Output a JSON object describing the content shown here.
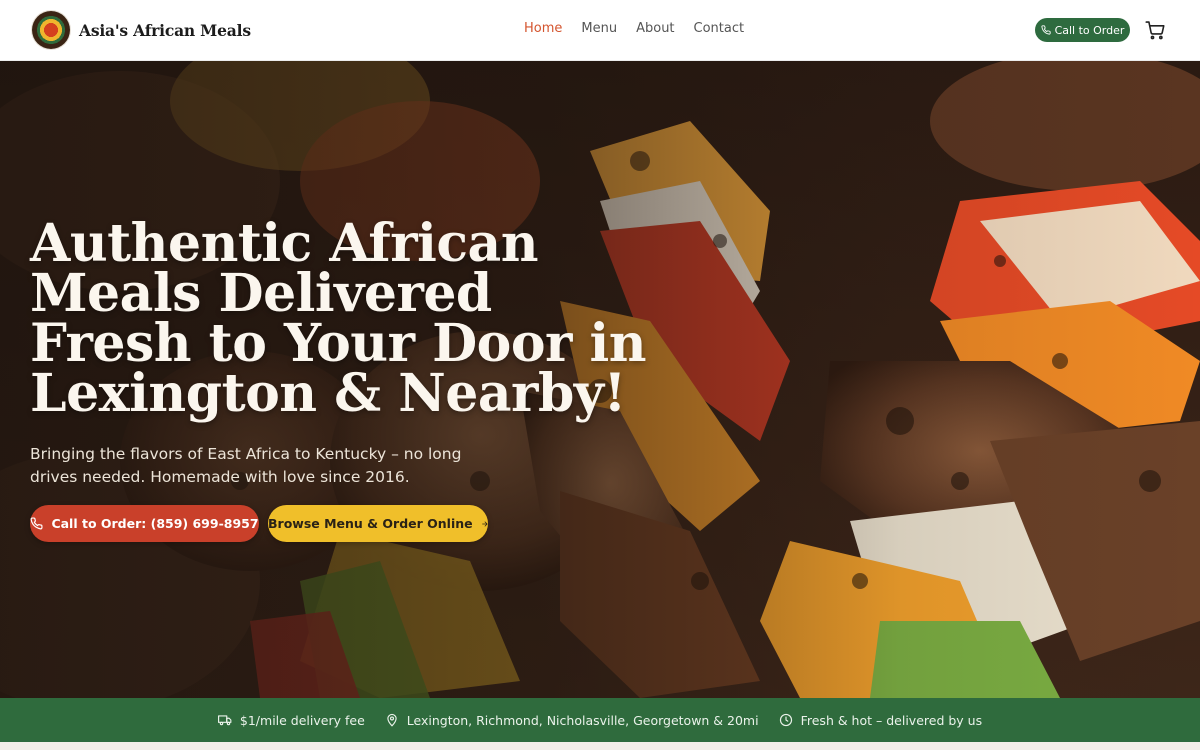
{
  "header": {
    "brand_name": "Asia's African Meals",
    "logo_icon": "logo-emblem",
    "nav": [
      {
        "label": "Home",
        "active": true
      },
      {
        "label": "Menu",
        "active": false
      },
      {
        "label": "About",
        "active": false
      },
      {
        "label": "Contact",
        "active": false
      }
    ],
    "cta_label": "Call to Order",
    "cta_icon": "phone-icon",
    "cart_icon": "cart-icon"
  },
  "hero": {
    "title": "Authentic African Meals Delivered Fresh to Your Door in Lexington & Nearby!",
    "subtitle": "Bringing the flavors of East Africa to Kentucky – no long drives needed. Homemade with love since 2016.",
    "call_button_label": "Call to Order: (859) 699-8957",
    "menu_button_label": "Browse Menu & Order Online",
    "menu_button_icon": "arrow-right-icon"
  },
  "info_strip": [
    {
      "icon": "truck-icon",
      "text": "$1/mile delivery fee"
    },
    {
      "icon": "map-pin-icon",
      "text": "Lexington, Richmond, Nicholasville, Georgetown & 20mi"
    },
    {
      "icon": "clock-icon",
      "text": "Fresh & hot – delivered by us"
    }
  ],
  "colors": {
    "accent_green": "#2e6b3f",
    "accent_red": "#c9402a",
    "accent_yellow": "#f0bf2a",
    "nav_active": "#d4552f"
  }
}
